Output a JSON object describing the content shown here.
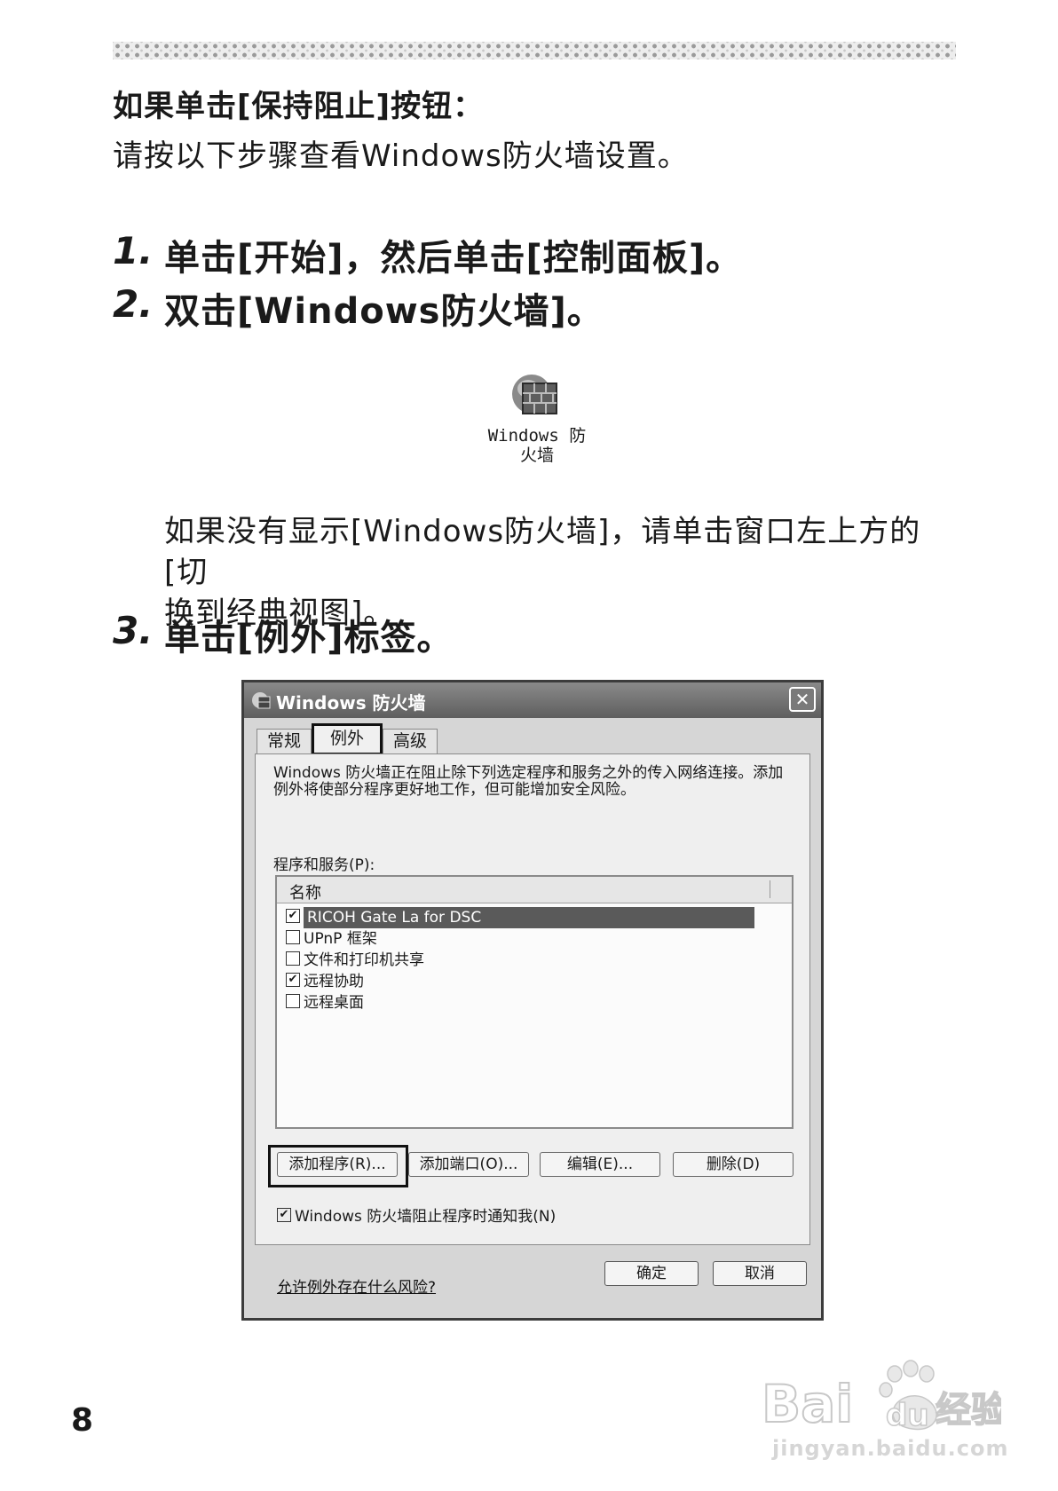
{
  "intro": {
    "heading": "如果单击[保持阻止]按钮：",
    "subheading": "请按以下步骤查看Windows防火墙设置。"
  },
  "steps": [
    {
      "num": "1.",
      "text": "单击[开始]，然后单击[控制面板]。"
    },
    {
      "num": "2.",
      "text": "双击[Windows防火墙]。"
    },
    {
      "num": "3.",
      "text": "单击[例外]标签。"
    }
  ],
  "desktop_icon": {
    "label_line1": "Windows 防",
    "label_line2": "火墙",
    "icon": "firewall-icon"
  },
  "note": {
    "line1": "如果没有显示[Windows防火墙]，请单击窗口左上方的[切",
    "line2": "换到经典视图]。"
  },
  "dialog": {
    "title": "Windows 防火墙",
    "close_label": "✕",
    "tabs": [
      "常规",
      "例外",
      "高级"
    ],
    "description": "Windows 防火墙正在阻止除下列选定程序和服务之外的传入网络连接。添加例外将使部分程序更好地工作，但可能增加安全风险。",
    "list_label": "程序和服务(P):",
    "list_header": "名称",
    "items": [
      {
        "label": "RICOH Gate La for DSC",
        "checked": "✔",
        "selected": true
      },
      {
        "label": "UPnP 框架",
        "checked": ""
      },
      {
        "label": "文件和打印机共享",
        "checked": ""
      },
      {
        "label": "远程协助",
        "checked": "✔"
      },
      {
        "label": "远程桌面",
        "checked": ""
      }
    ],
    "buttons": {
      "add_program": "添加程序(R)...",
      "add_port": "添加端口(O)...",
      "edit": "编辑(E)...",
      "delete": "删除(D)"
    },
    "notify_check": "✔",
    "notify_label": "Windows 防火墙阻止程序时通知我(N)",
    "risk_link": "允许例外存在什么风险?",
    "ok": "确定",
    "cancel": "取消"
  },
  "page_number": "8",
  "watermark": {
    "brand": "Bai",
    "brand2": "du",
    "brand3": "经验",
    "url": "jingyan.baidu.com"
  },
  "colors": {
    "title_bar": "#6e6e6e",
    "selection": "#5a5a5a",
    "dialog_bg": "#d6d6d6"
  }
}
